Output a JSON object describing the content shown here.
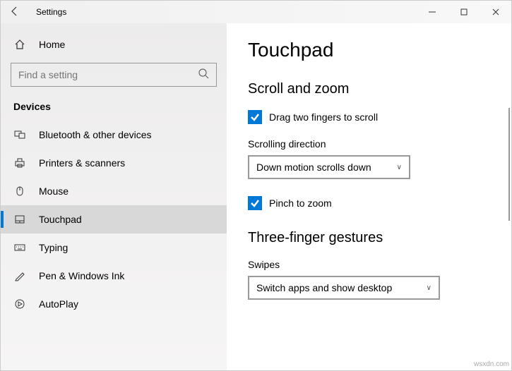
{
  "window": {
    "title": "Settings"
  },
  "sidebar": {
    "home": "Home",
    "search_placeholder": "Find a setting",
    "section": "Devices",
    "items": [
      {
        "label": "Bluetooth & other devices"
      },
      {
        "label": "Printers & scanners"
      },
      {
        "label": "Mouse"
      },
      {
        "label": "Touchpad"
      },
      {
        "label": "Typing"
      },
      {
        "label": "Pen & Windows Ink"
      },
      {
        "label": "AutoPlay"
      }
    ]
  },
  "content": {
    "title": "Touchpad",
    "section1": "Scroll and zoom",
    "check1": "Drag two fingers to scroll",
    "dir_label": "Scrolling direction",
    "dir_value": "Down motion scrolls down",
    "check2": "Pinch to zoom",
    "section2": "Three-finger gestures",
    "swipes_label": "Swipes",
    "swipes_value": "Switch apps and show desktop"
  },
  "watermark": "wsxdn.com"
}
